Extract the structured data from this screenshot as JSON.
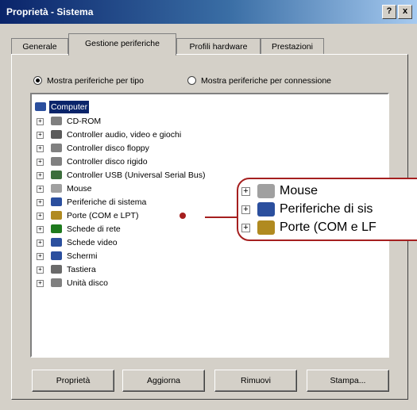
{
  "window": {
    "title": "Proprietà - Sistema",
    "help_label": "?",
    "close_label": "x"
  },
  "tabs": [
    {
      "label": "Generale",
      "active": false
    },
    {
      "label": "Gestione periferiche",
      "active": true
    },
    {
      "label": "Profili hardware",
      "active": false
    },
    {
      "label": "Prestazioni",
      "active": false
    }
  ],
  "view_options": [
    {
      "label": "Mostra periferiche per tipo",
      "selected": true
    },
    {
      "label": "Mostra periferiche per connessione",
      "selected": false
    }
  ],
  "tree": {
    "root": {
      "label": "Computer",
      "icon": "computer-icon"
    },
    "items": [
      {
        "label": "CD-ROM",
        "icon": "cdrom-icon",
        "color": "#7f7f7f"
      },
      {
        "label": "Controller audio, video e giochi",
        "icon": "audio-icon",
        "color": "#5a5a5a"
      },
      {
        "label": "Controller disco floppy",
        "icon": "floppy-icon",
        "color": "#808080"
      },
      {
        "label": "Controller disco rigido",
        "icon": "harddisk-icon",
        "color": "#808080"
      },
      {
        "label": "Controller USB (Universal Serial Bus)",
        "icon": "usb-icon",
        "color": "#3c6e3c"
      },
      {
        "label": "Mouse",
        "icon": "mouse-icon",
        "color": "#a0a0a0"
      },
      {
        "label": "Periferiche di sistema",
        "icon": "system-device-icon",
        "color": "#2b4f9e"
      },
      {
        "label": "Porte (COM e LPT)",
        "icon": "port-icon",
        "color": "#b08a20"
      },
      {
        "label": "Schede di rete",
        "icon": "network-card-icon",
        "color": "#1e7a1e"
      },
      {
        "label": "Schede video",
        "icon": "video-card-icon",
        "color": "#2b4f9e"
      },
      {
        "label": "Schermi",
        "icon": "monitor-icon",
        "color": "#2b4f9e"
      },
      {
        "label": "Tastiera",
        "icon": "keyboard-icon",
        "color": "#6a6a6a"
      },
      {
        "label": "Unità disco",
        "icon": "disk-drive-icon",
        "color": "#808080"
      }
    ]
  },
  "callout": {
    "items": [
      {
        "label": "Mouse",
        "icon": "mouse-icon",
        "color": "#a0a0a0"
      },
      {
        "label": "Periferiche di sis",
        "icon": "system-device-icon",
        "color": "#2b4f9e"
      },
      {
        "label": "Porte (COM e LF",
        "icon": "port-icon",
        "color": "#b08a20"
      }
    ],
    "accent_color": "#a51f1f"
  },
  "buttons": {
    "properties": "Proprietà",
    "refresh": "Aggiorna",
    "remove": "Rimuovi",
    "print": "Stampa..."
  }
}
